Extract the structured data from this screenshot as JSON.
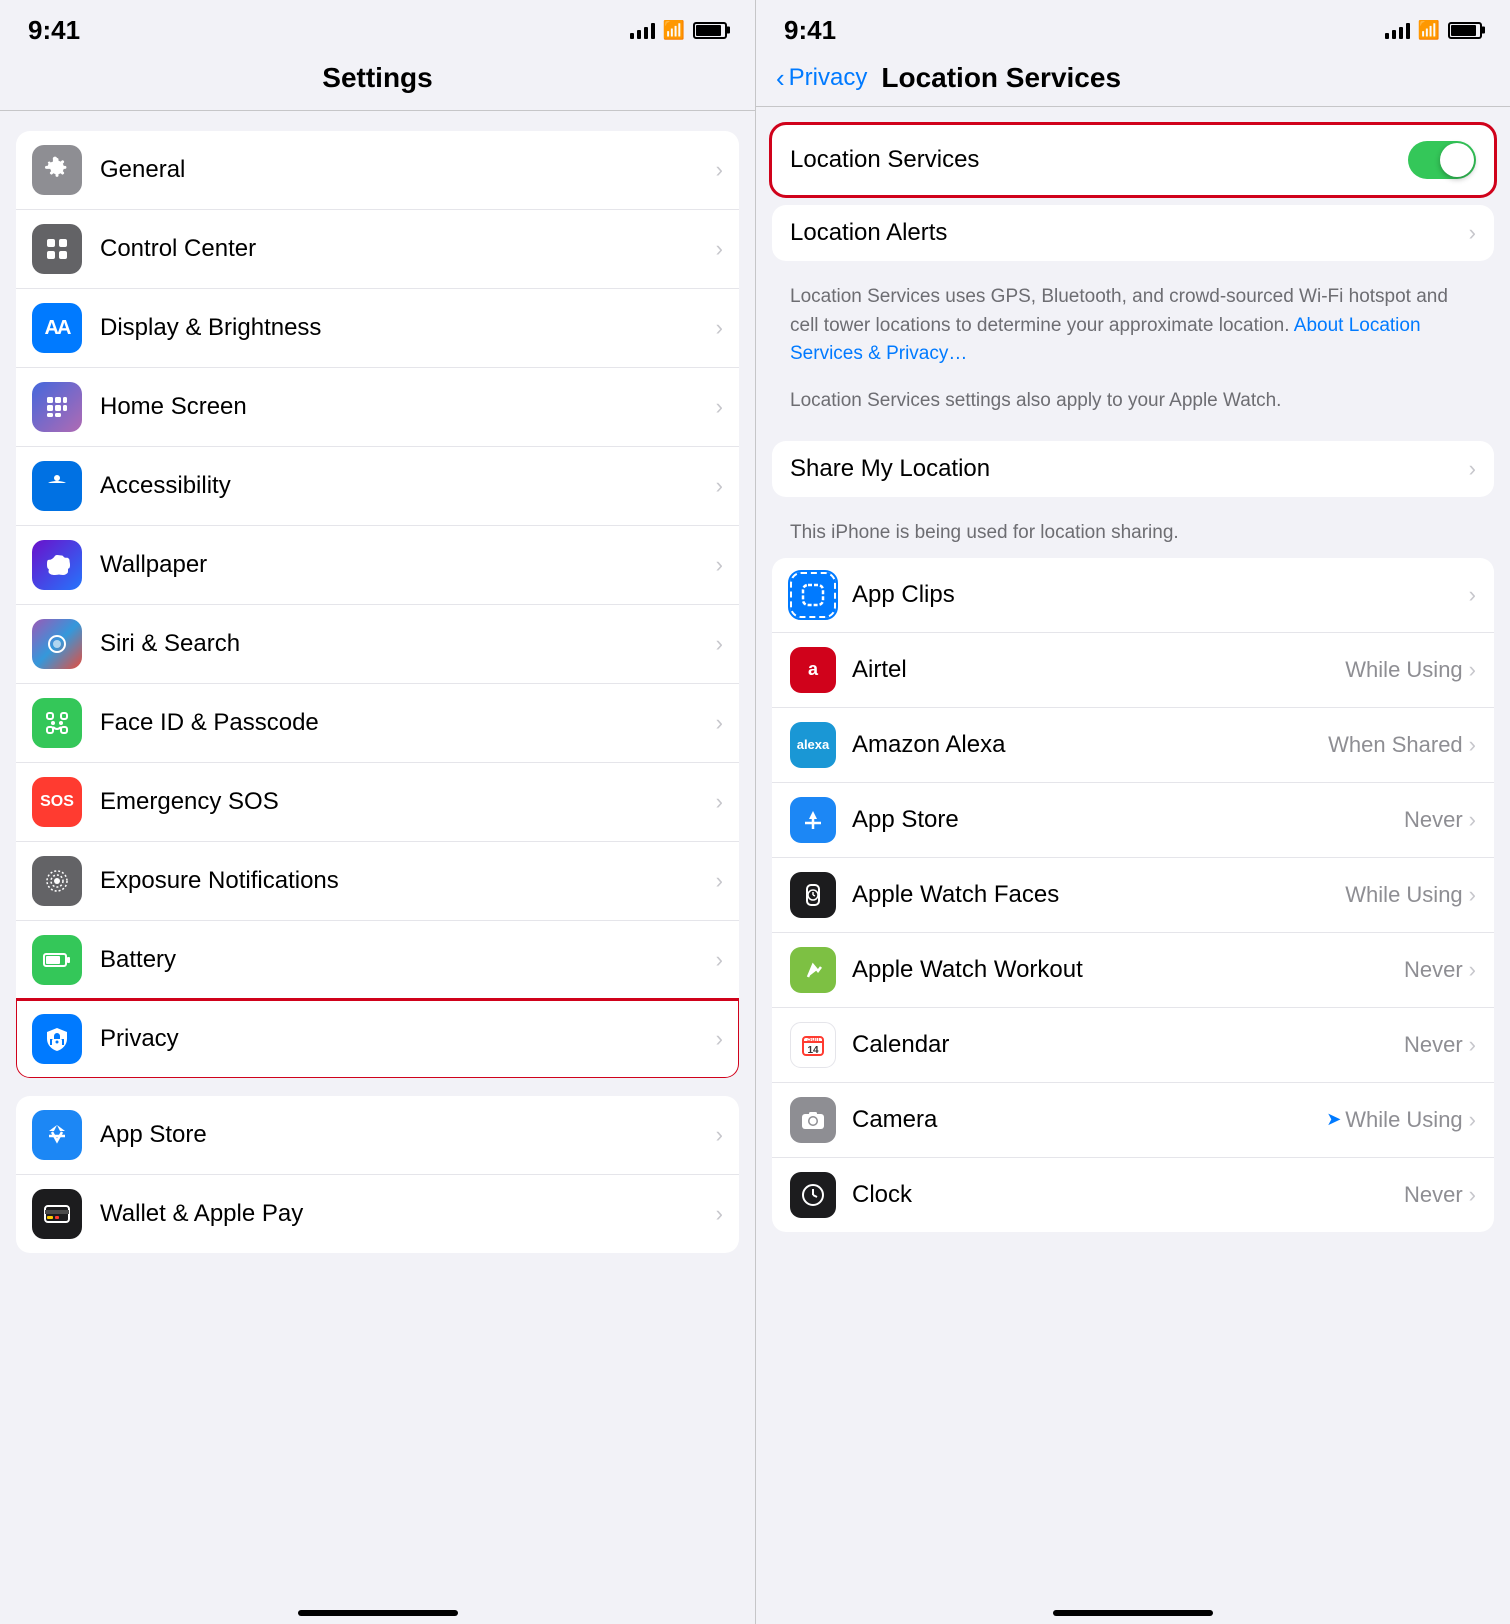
{
  "left": {
    "time": "9:41",
    "title": "Settings",
    "groups": [
      {
        "items": [
          {
            "id": "general",
            "label": "General",
            "iconBg": "icon-gray",
            "iconChar": "⚙"
          },
          {
            "id": "control-center",
            "label": "Control Center",
            "iconBg": "icon-gray2",
            "iconChar": "⊞"
          },
          {
            "id": "display",
            "label": "Display & Brightness",
            "iconBg": "icon-blue",
            "iconChar": "AA"
          },
          {
            "id": "home-screen",
            "label": "Home Screen",
            "iconBg": "icon-indigo",
            "iconChar": "⋮⋮"
          },
          {
            "id": "accessibility",
            "label": "Accessibility",
            "iconBg": "icon-blue2",
            "iconChar": "♿"
          },
          {
            "id": "wallpaper",
            "label": "Wallpaper",
            "iconBg": "icon-blue2",
            "iconChar": "✿"
          },
          {
            "id": "siri",
            "label": "Siri & Search",
            "iconBg": "icon-dark",
            "iconChar": "◉"
          },
          {
            "id": "faceid",
            "label": "Face ID & Passcode",
            "iconBg": "icon-green",
            "iconChar": "🔳"
          },
          {
            "id": "sos",
            "label": "Emergency SOS",
            "iconBg": "icon-red",
            "iconChar": "SOS"
          },
          {
            "id": "exposure",
            "label": "Exposure Notifications",
            "iconBg": "icon-gray2",
            "iconChar": "◎"
          },
          {
            "id": "battery",
            "label": "Battery",
            "iconBg": "icon-green",
            "iconChar": "🔋"
          },
          {
            "id": "privacy",
            "label": "Privacy",
            "iconBg": "icon-blue",
            "iconChar": "✋",
            "highlighted": true
          }
        ]
      },
      {
        "items": [
          {
            "id": "appstore",
            "label": "App Store",
            "iconBg": "icon-blue",
            "iconChar": "A"
          },
          {
            "id": "wallet",
            "label": "Wallet & Apple Pay",
            "iconBg": "icon-dark",
            "iconChar": "💳"
          }
        ]
      }
    ]
  },
  "right": {
    "time": "9:41",
    "backLabel": "Privacy",
    "title": "Location Services",
    "locationServicesLabel": "Location Services",
    "locationServicesOn": true,
    "locationAlertsLabel": "Location Alerts",
    "infoText1": "Location Services uses GPS, Bluetooth, and crowd-sourced Wi-Fi hotspot and cell tower locations to determine your approximate location.",
    "infoLink": "About Location Services & Privacy…",
    "infoText2": "Location Services settings also apply to your Apple Watch.",
    "shareMyLocationLabel": "Share My Location",
    "shareMyLocationSub": "This iPhone is being used for location sharing.",
    "apps": [
      {
        "id": "app-clips",
        "label": "App Clips",
        "status": "",
        "iconBg": "#007aff",
        "iconType": "app-clips"
      },
      {
        "id": "airtel",
        "label": "Airtel",
        "status": "While Using",
        "iconBg": "#d0021b",
        "iconType": "airtel"
      },
      {
        "id": "alexa",
        "label": "Amazon Alexa",
        "status": "When Shared",
        "iconBg": "#1a97d5",
        "iconType": "alexa"
      },
      {
        "id": "app-store",
        "label": "App Store",
        "status": "Never",
        "iconBg": "#1c87f5",
        "iconType": "app-store"
      },
      {
        "id": "apple-watch-faces",
        "label": "Apple Watch Faces",
        "status": "While Using",
        "iconBg": "#1c1c1e",
        "iconType": "watch"
      },
      {
        "id": "apple-watch-workout",
        "label": "Apple Watch Workout",
        "status": "Never",
        "iconBg": "#7dc043",
        "iconType": "workout"
      },
      {
        "id": "calendar",
        "label": "Calendar",
        "status": "Never",
        "iconBg": "#fff",
        "iconType": "calendar"
      },
      {
        "id": "camera",
        "label": "Camera",
        "status": "While Using",
        "hasArrow": true,
        "iconBg": "#8e8e93",
        "iconType": "camera"
      },
      {
        "id": "clock",
        "label": "Clock",
        "status": "Never",
        "iconBg": "#1c1c1e",
        "iconType": "clock"
      }
    ]
  }
}
